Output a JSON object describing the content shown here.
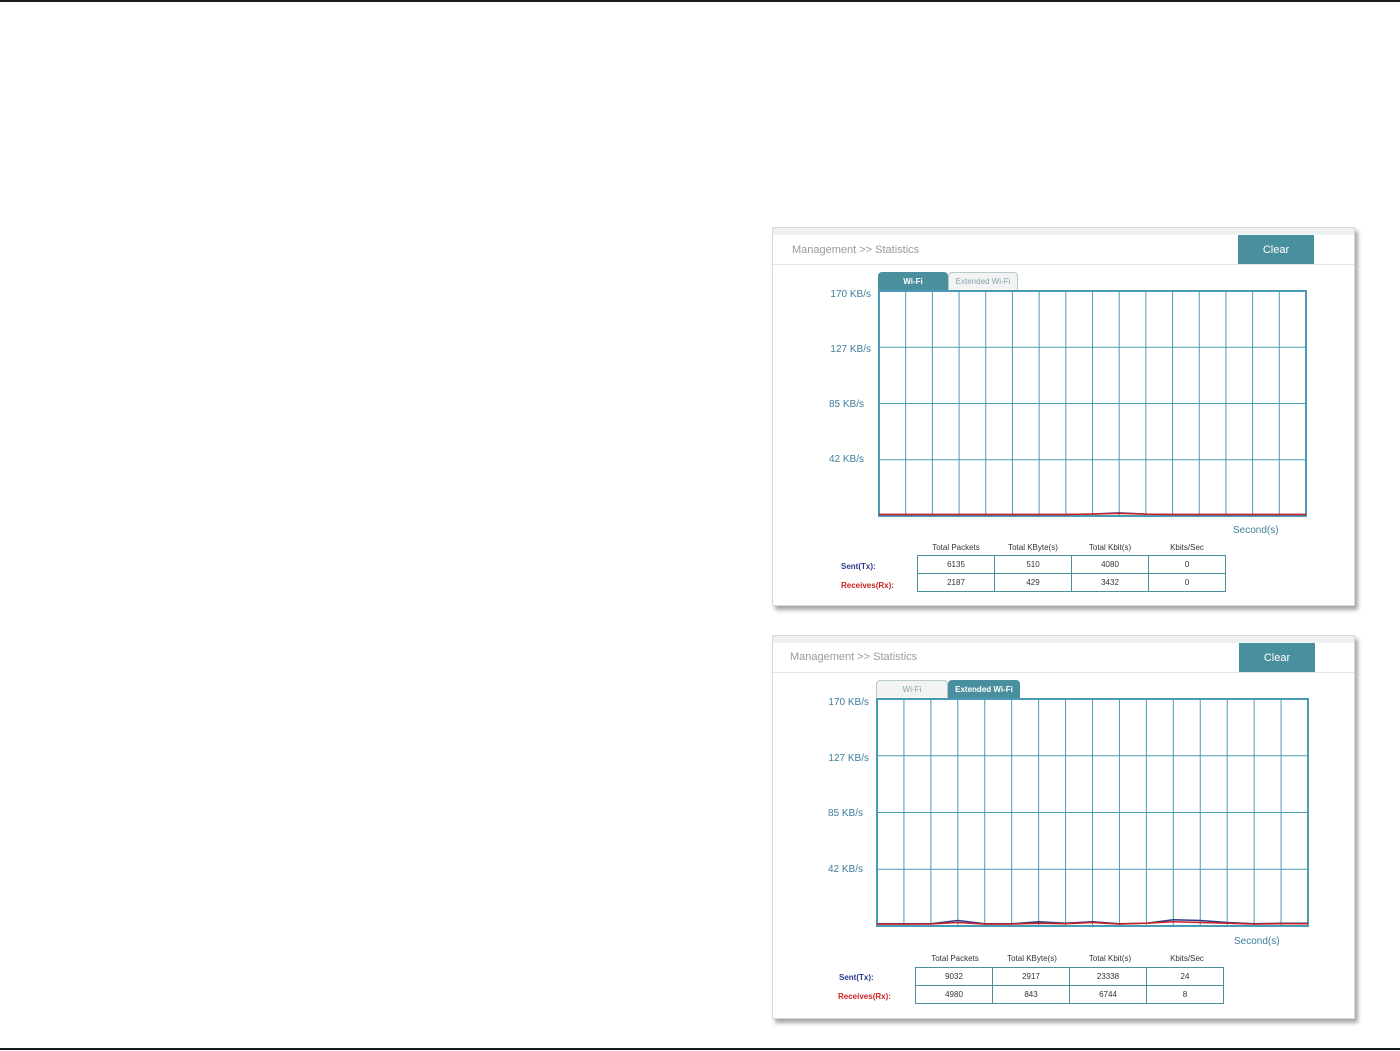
{
  "panels": [
    {
      "breadcrumb": "Management >> Statistics",
      "clear_label": "Clear",
      "tabs": [
        {
          "label": "Wi-Fi",
          "active": true
        },
        {
          "label": "Extended Wi-Fi",
          "active": false
        }
      ],
      "y_labels": [
        "170 KB/s",
        "127 KB/s",
        "85 KB/s",
        "42 KB/s"
      ],
      "x_label": "Second(s)",
      "table": {
        "headers": [
          "Total Packets",
          "Total KByte(s)",
          "Total Kbit(s)",
          "Kbits/Sec"
        ],
        "rows": [
          {
            "label": "Sent(Tx):",
            "values": [
              "6135",
              "510",
              "4080",
              "0"
            ]
          },
          {
            "label": "Receives(Rx):",
            "values": [
              "2187",
              "429",
              "3432",
              "0"
            ]
          }
        ]
      }
    },
    {
      "breadcrumb": "Management >> Statistics",
      "clear_label": "Clear",
      "tabs": [
        {
          "label": "Wi-Fi",
          "active": false
        },
        {
          "label": "Extended Wi-Fi",
          "active": true
        }
      ],
      "y_labels": [
        "170 KB/s",
        "127 KB/s",
        "85 KB/s",
        "42 KB/s"
      ],
      "x_label": "Second(s)",
      "table": {
        "headers": [
          "Total Packets",
          "Total KByte(s)",
          "Total Kbit(s)",
          "Kbits/Sec"
        ],
        "rows": [
          {
            "label": "Sent(Tx):",
            "values": [
              "9032",
              "2917",
              "23338",
              "24"
            ]
          },
          {
            "label": "Receives(Rx):",
            "values": [
              "4980",
              "843",
              "6744",
              "8"
            ]
          }
        ]
      }
    }
  ],
  "colors": {
    "accent": "#4a8f9e",
    "grid": "#4a9bb5",
    "tx_line": "#2b3a8f",
    "rx_line": "#cc2222"
  },
  "chart_data": [
    {
      "type": "line",
      "ylim": [
        0,
        170
      ],
      "y_ticks": [
        "170 KB/s",
        "127 KB/s",
        "85 KB/s",
        "42 KB/s"
      ],
      "xlabel": "Second(s)",
      "grid": true,
      "series": [
        {
          "values": [
            0,
            0,
            0,
            0,
            0,
            0,
            0,
            0,
            0.4,
            1.2,
            0.3,
            0,
            0,
            0,
            0,
            0,
            0
          ]
        },
        {
          "values": [
            0,
            0,
            0,
            0,
            0,
            0,
            0,
            0,
            0.3,
            0.8,
            0.2,
            0,
            0,
            0,
            0,
            0,
            0
          ]
        }
      ]
    },
    {
      "type": "line",
      "ylim": [
        0,
        170
      ],
      "y_ticks": [
        "170 KB/s",
        "127 KB/s",
        "85 KB/s",
        "42 KB/s"
      ],
      "xlabel": "Second(s)",
      "grid": true,
      "series": [
        {
          "values": [
            0.5,
            0.5,
            0.5,
            3,
            0.5,
            0.5,
            2,
            1,
            2,
            0.5,
            1,
            3.5,
            3,
            1.5,
            0.5,
            1,
            1
          ]
        },
        {
          "values": [
            0.3,
            0.3,
            0.4,
            1.5,
            0.3,
            0.3,
            1,
            0.5,
            1.5,
            0.3,
            1,
            2,
            1.5,
            1,
            0.3,
            0.5,
            0.6
          ]
        }
      ]
    }
  ]
}
